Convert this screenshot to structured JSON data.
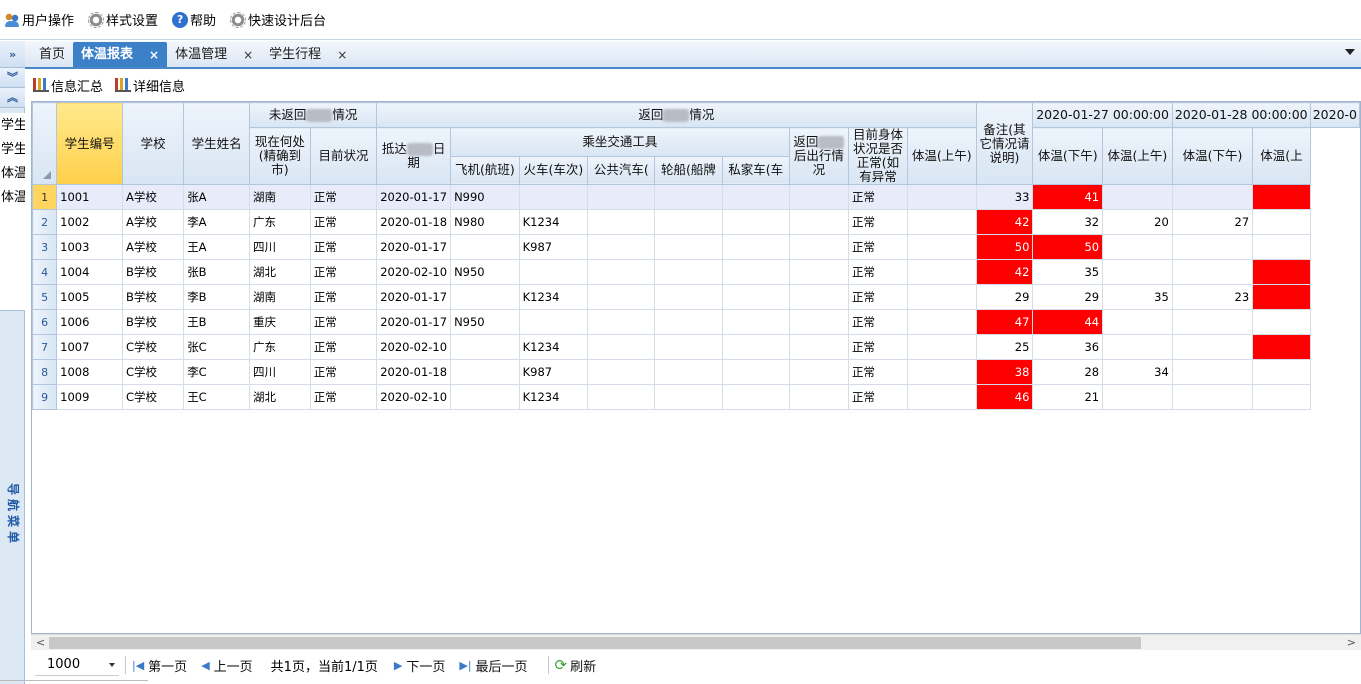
{
  "menu": [
    {
      "label": "用户操作",
      "icon": "users-icon"
    },
    {
      "label": "样式设置",
      "icon": "gear-icon"
    },
    {
      "label": "帮助",
      "icon": "help-icon"
    },
    {
      "label": "快速设计后台",
      "icon": "gear-icon"
    }
  ],
  "left_strip": {
    "expand_glyph": "»",
    "down_glyph": "︾",
    "up_glyph": "︽",
    "items": [
      "学生",
      "学生",
      "体温",
      "体温"
    ],
    "nav_label": "导航菜单"
  },
  "tabs": [
    {
      "label": "首页",
      "closable": false
    },
    {
      "label": "体温报表",
      "closable": true,
      "active": true
    },
    {
      "label": "体温管理",
      "closable": true
    },
    {
      "label": "学生行程",
      "closable": true
    }
  ],
  "tab_close_glyph": "×",
  "toolbar": {
    "summary": "信息汇总",
    "detail": "详细信息"
  },
  "grid": {
    "groups": {
      "not_returned": [
        "未返回",
        "情况"
      ],
      "returned": [
        "返回",
        "情况"
      ],
      "transport": "乘坐交通工具"
    },
    "headers": {
      "student_no": "学生编号",
      "school": "学校",
      "name": "学生姓名",
      "location": "现在何处(精确到市)",
      "status": "目前状况",
      "arrive_date": [
        "抵达",
        "日期"
      ],
      "plane": "飞机(航班)",
      "train": "火车(车次)",
      "bus": "公共汽车(",
      "ship": "轮船(船牌",
      "car": "私家车(车",
      "after_return": [
        "返回",
        "后出行情况"
      ],
      "health": "目前身体状况是否正常(如有异常",
      "remark": "备注(其它情况请说明)"
    },
    "dates": [
      "2020-01-27 00:00:00",
      "2020-01-28 00:00:00",
      "2020-0"
    ],
    "am": "体温(上午)",
    "pm": "体温(下午)",
    "am_cut": "体温(上",
    "rows": [
      {
        "rn": "1",
        "no": "1001",
        "school": "A学校",
        "name": "张A",
        "loc": "湖南",
        "status": "正常",
        "date": "2020-01-17",
        "plane": "N990",
        "train": "",
        "health": "正常",
        "t1": "33",
        "t2": "41",
        "t3": "",
        "t4": "",
        "t5": "",
        "hot": [
          false,
          true,
          false,
          false,
          true
        ]
      },
      {
        "rn": "2",
        "no": "1002",
        "school": "A学校",
        "name": "李A",
        "loc": "广东",
        "status": "正常",
        "date": "2020-01-18",
        "plane": "N980",
        "train": "K1234",
        "health": "正常",
        "t1": "42",
        "t2": "32",
        "t3": "20",
        "t4": "27",
        "t5": "",
        "hot": [
          true,
          false,
          false,
          false,
          false
        ]
      },
      {
        "rn": "3",
        "no": "1003",
        "school": "A学校",
        "name": "王A",
        "loc": "四川",
        "status": "正常",
        "date": "2020-01-17",
        "plane": "",
        "train": "K987",
        "health": "正常",
        "t1": "50",
        "t2": "50",
        "t3": "",
        "t4": "",
        "t5": "",
        "hot": [
          true,
          true,
          false,
          false,
          false
        ]
      },
      {
        "rn": "4",
        "no": "1004",
        "school": "B学校",
        "name": "张B",
        "loc": "湖北",
        "status": "正常",
        "date": "2020-02-10",
        "plane": "N950",
        "train": "",
        "health": "正常",
        "t1": "42",
        "t2": "35",
        "t3": "",
        "t4": "",
        "t5": "",
        "hot": [
          true,
          false,
          false,
          false,
          true
        ]
      },
      {
        "rn": "5",
        "no": "1005",
        "school": "B学校",
        "name": "李B",
        "loc": "湖南",
        "status": "正常",
        "date": "2020-01-17",
        "plane": "",
        "train": "K1234",
        "health": "正常",
        "t1": "29",
        "t2": "29",
        "t3": "35",
        "t4": "23",
        "t5": "",
        "hot": [
          false,
          false,
          false,
          false,
          true
        ]
      },
      {
        "rn": "6",
        "no": "1006",
        "school": "B学校",
        "name": "王B",
        "loc": "重庆",
        "status": "正常",
        "date": "2020-01-17",
        "plane": "N950",
        "train": "",
        "health": "正常",
        "t1": "47",
        "t2": "44",
        "t3": "",
        "t4": "",
        "t5": "",
        "hot": [
          true,
          true,
          false,
          false,
          false
        ]
      },
      {
        "rn": "7",
        "no": "1007",
        "school": "C学校",
        "name": "张C",
        "loc": "广东",
        "status": "正常",
        "date": "2020-02-10",
        "plane": "",
        "train": "K1234",
        "health": "正常",
        "t1": "25",
        "t2": "36",
        "t3": "",
        "t4": "",
        "t5": "",
        "hot": [
          false,
          false,
          false,
          false,
          true
        ]
      },
      {
        "rn": "8",
        "no": "1008",
        "school": "C学校",
        "name": "李C",
        "loc": "四川",
        "status": "正常",
        "date": "2020-01-18",
        "plane": "",
        "train": "K987",
        "health": "正常",
        "t1": "38",
        "t2": "28",
        "t3": "34",
        "t4": "",
        "t5": "",
        "hot": [
          true,
          false,
          false,
          false,
          false
        ]
      },
      {
        "rn": "9",
        "no": "1009",
        "school": "C学校",
        "name": "王C",
        "loc": "湖北",
        "status": "正常",
        "date": "2020-02-10",
        "plane": "",
        "train": "K1234",
        "health": "正常",
        "t1": "46",
        "t2": "21",
        "t3": "",
        "t4": "",
        "t5": "",
        "hot": [
          true,
          false,
          false,
          false,
          false
        ]
      }
    ]
  },
  "scroll": {
    "left": "<",
    "right": ">"
  },
  "pager": {
    "page_size": "1000",
    "first": "第一页",
    "prev": "上一页",
    "info": "共1页，当前1/1页",
    "next": "下一页",
    "last": "最后一页",
    "refresh": "刷新"
  },
  "colors": {
    "accent": "#3c80c8",
    "hot": "#ff0000",
    "header": "#d8e5f3"
  }
}
